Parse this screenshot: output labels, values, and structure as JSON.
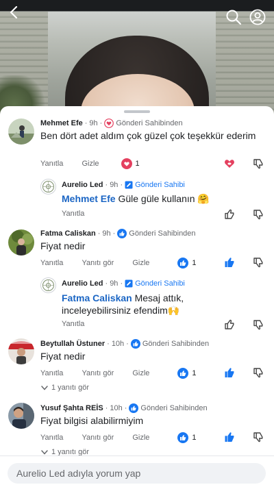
{
  "colors": {
    "accent": "#1877f2",
    "mention": "#1a65c4",
    "heart": "#e4405f",
    "muted": "#65676b"
  },
  "comments": [
    {
      "author": "Mehmet Efe",
      "time": "9h",
      "badge": "Gönderi Sahibinden",
      "badge_icon": "heart-badge-icon",
      "text": "Ben dört adet aldım çok güzel çok teşekkür ederim",
      "actions": [
        "Yanıtla",
        "Gizle"
      ],
      "reaction": {
        "icon": "heart-reaction-icon",
        "count": "1"
      }
    },
    {
      "author": "Aurelio Led",
      "time": "9h",
      "badge": "Gönderi Sahibi",
      "badge_icon": "pencil-icon",
      "mention": "Mehmet Efe",
      "text": "Güle güle kullanın 🤗",
      "actions": [
        "Yanıtla"
      ]
    },
    {
      "author": "Fatma Caliskan",
      "time": "9h",
      "badge": "Gönderi Sahibinden",
      "badge_icon": "like-badge-icon",
      "text": "Fiyat nedir",
      "actions": [
        "Yanıtla",
        "Yanıtı gör",
        "Gizle"
      ],
      "reaction": {
        "icon": "like-reaction-icon",
        "count": "1"
      }
    },
    {
      "author": "Aurelio Led",
      "time": "9h",
      "badge": "Gönderi Sahibi",
      "badge_icon": "pencil-icon",
      "mention": "Fatma Caliskan",
      "text": "Mesaj attık, inceleyebilirsiniz efendim🙌",
      "actions": [
        "Yanıtla"
      ]
    },
    {
      "author": "Beytullah Üstuner",
      "time": "10h",
      "badge": "Gönderi Sahibinden",
      "badge_icon": "like-badge-icon",
      "text": "Fiyat nedir",
      "actions": [
        "Yanıtla",
        "Yanıtı gör",
        "Gizle"
      ],
      "reaction": {
        "icon": "like-reaction-icon",
        "count": "1"
      },
      "replies_label": "1 yanıtı gör"
    },
    {
      "author": "Yusuf Şahta REİS",
      "time": "10h",
      "badge": "Gönderi Sahibinden",
      "badge_icon": "like-badge-icon",
      "text": "Fiyat bilgisi alabilirmiyim",
      "actions": [
        "Yanıtla",
        "Yanıtı gör",
        "Gizle"
      ],
      "reaction": {
        "icon": "like-reaction-icon",
        "count": "1"
      },
      "replies_label": "1 yanıtı gör"
    }
  ],
  "input": {
    "placeholder": "Aurelio Led adıyla yorum yap"
  },
  "icons": [
    "back-arrow-icon",
    "search-icon",
    "account-icon",
    "dislike-icon",
    "like-outline-icon"
  ]
}
